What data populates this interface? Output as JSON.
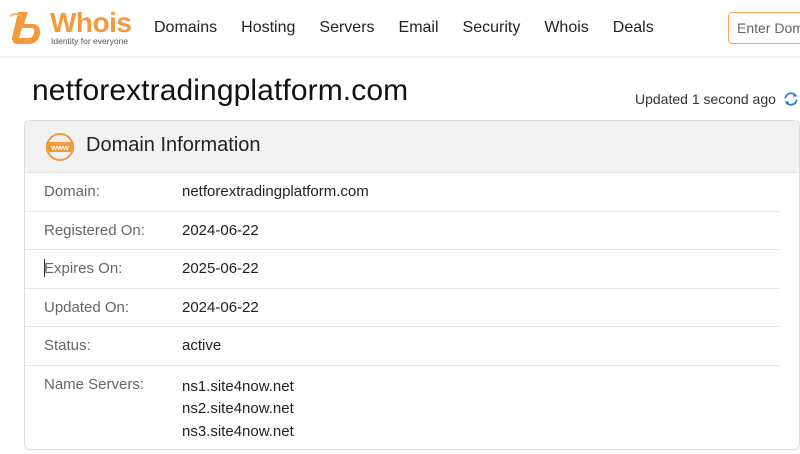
{
  "header": {
    "logo_word": "Whois",
    "logo_tagline": "Identity for everyone",
    "nav": [
      "Domains",
      "Hosting",
      "Servers",
      "Email",
      "Security",
      "Whois",
      "Deals"
    ],
    "search_placeholder": "Enter Domain"
  },
  "page": {
    "title": "netforextradingplatform.com",
    "updated": "Updated 1 second ago"
  },
  "card": {
    "title": "Domain Information",
    "rows": [
      {
        "label": "Domain:",
        "value": "netforextradingplatform.com"
      },
      {
        "label": "Registered On:",
        "value": "2024-06-22"
      },
      {
        "label": "Expires On:",
        "value": "2025-06-22"
      },
      {
        "label": "Updated On:",
        "value": "2024-06-22"
      },
      {
        "label": "Status:",
        "value": "active"
      }
    ],
    "name_servers_label": "Name Servers:",
    "name_servers": [
      "ns1.site4now.net",
      "ns2.site4now.net",
      "ns3.site4now.net"
    ]
  },
  "colors": {
    "brand_orange": "#f39a3c",
    "refresh_blue": "#2b7de1"
  }
}
